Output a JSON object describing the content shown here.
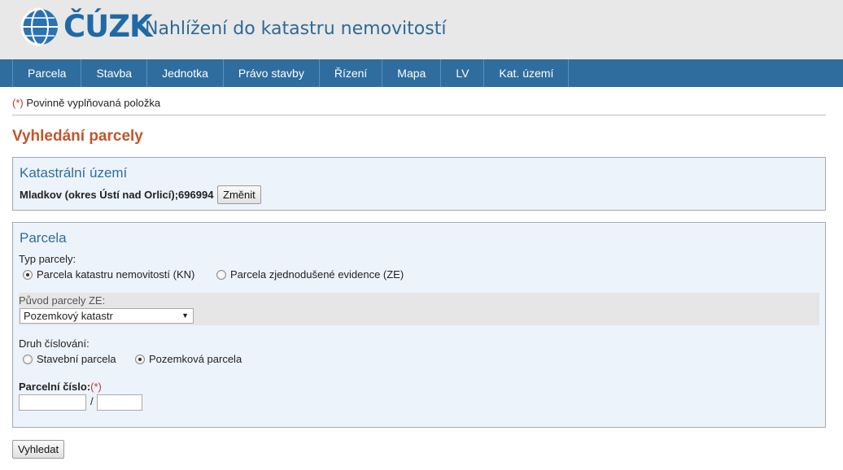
{
  "header": {
    "logo_text": "ČÚZK",
    "site_title": "Nahlížení do katastru nemovitostí"
  },
  "nav": {
    "items": [
      "Parcela",
      "Stavba",
      "Jednotka",
      "Právo stavby",
      "Řízení",
      "Mapa",
      "LV",
      "Kat. území"
    ]
  },
  "required_note": {
    "marker": "(*)",
    "text": " Povinně vyplňovaná položka"
  },
  "page_title": "Vyhledání parcely",
  "ku_panel": {
    "title": "Katastrální území",
    "value": "Mladkov (okres Ústí nad Orlicí);696994",
    "change_button": "Změnit"
  },
  "parcela_panel": {
    "title": "Parcela",
    "typ_label": "Typ parcely:",
    "typ_options": [
      {
        "label": "Parcela katastru nemovitostí (KN)",
        "checked": true
      },
      {
        "label": "Parcela zjednodušené evidence (ZE)",
        "checked": false
      }
    ],
    "puvod_label": "Původ parcely ZE:",
    "puvod_selected": "Pozemkový katastr",
    "druh_label": "Druh číslování:",
    "druh_options": [
      {
        "label": "Stavební parcela",
        "checked": false
      },
      {
        "label": "Pozemková parcela",
        "checked": true
      }
    ],
    "cislo_label": "Parcelní číslo:",
    "cislo_required": "(*)",
    "cislo_main_value": "",
    "cislo_sub_value": "",
    "separator": "/"
  },
  "search_button": "Vyhledat"
}
